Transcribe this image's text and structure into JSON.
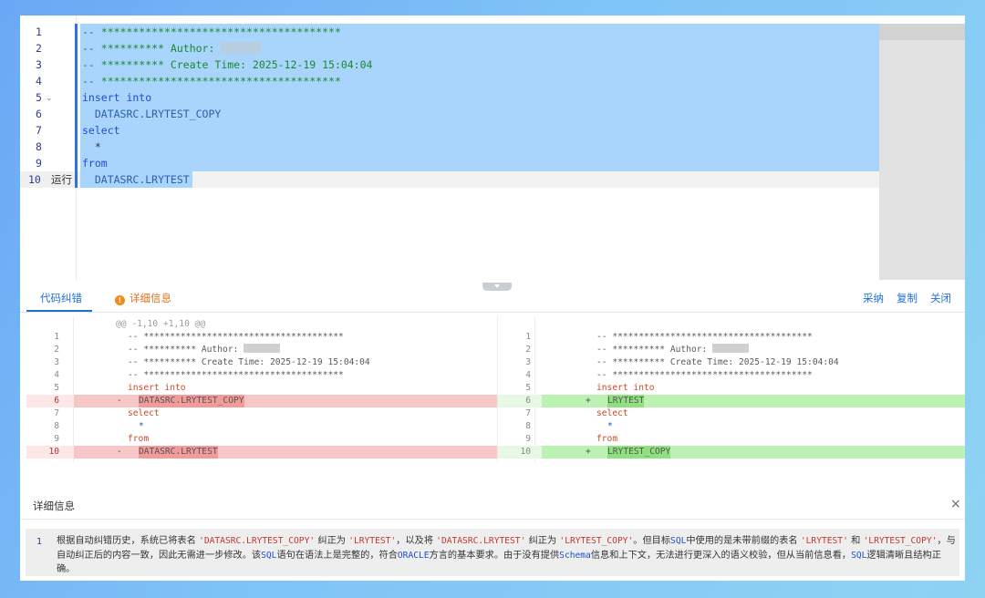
{
  "editor": {
    "run_label": "运行",
    "line_numbers": [
      "1",
      "2",
      "3",
      "4",
      "5",
      "6",
      "7",
      "8",
      "9",
      "10"
    ],
    "lines": {
      "l1": "-- **************************************",
      "l2": "-- ********** Author:",
      "l3": "-- ********** Create Time: 2025-12-19 15:04:04",
      "l4": "-- **************************************",
      "l5": "insert into",
      "l6": "  DATASRC.LRYTEST_COPY",
      "l7": "select",
      "l8": "  *",
      "l9": "from",
      "l10": "  DATASRC.LRYTEST"
    }
  },
  "tabs": {
    "correct": "代码纠错",
    "detail": "详细信息",
    "detail_icon": "!"
  },
  "actions": {
    "adopt": "采纳",
    "copy": "复制",
    "close": "关闭"
  },
  "diff": {
    "hunk": "@@ -1,10 +1,10 @@",
    "left": {
      "nums": [
        "1",
        "2",
        "3",
        "4",
        "5",
        "6",
        "7",
        "8",
        "9",
        "10"
      ],
      "l1": "-- **************************************",
      "l2": "-- ********** Author:",
      "l3": "-- ********** Create Time: 2025-12-19 15:04:04",
      "l4": "-- **************************************",
      "l5": "insert into",
      "l6": "DATASRC.LRYTEST_COPY",
      "l7": "select",
      "l8": "*",
      "l9": "from",
      "l10": "DATASRC.LRYTEST",
      "minus": "-"
    },
    "right": {
      "nums": [
        "1",
        "2",
        "3",
        "4",
        "5",
        "6",
        "7",
        "8",
        "9",
        "10"
      ],
      "l1": "-- **************************************",
      "l2": "-- ********** Author:",
      "l3": "-- ********** Create Time: 2025-12-19 15:04:04",
      "l4": "-- **************************************",
      "l5": "insert into",
      "l6": "LRYTEST",
      "l7": "select",
      "l8": "*",
      "l9": "from",
      "l10": "LRYTEST_COPY",
      "plus": "+"
    }
  },
  "detail_panel": {
    "title": "详细信息",
    "close_icon": "×",
    "line_number": "1",
    "segments": [
      "根据自动纠错历史，系统已将表名 ",
      "'DATASRC.LRYTEST_COPY'",
      " 纠正为 ",
      "'LRYTEST'",
      "，以及将 ",
      "'DATASRC.LRYTEST'",
      " 纠正为 ",
      "'LRYTEST_COPY'",
      "。但目标",
      "SQL",
      "中使用的是未带前缀的表名 ",
      "'LRYTEST'",
      " 和 ",
      "'LRYTEST_COPY'",
      "，与自动纠正后的内容一致，因此无需进一步修改。该",
      "SQL",
      "语句在语法上是完整的，符合",
      "ORACLE",
      "方言的基本要求。由于没有提供",
      "Schema",
      "信息和上下文，无法进行更深入的语义校验，但从当前信息看，",
      "SQL",
      "逻辑清晰且结构正确。"
    ]
  },
  "colors": {
    "selection": "#a9d4fb",
    "comment": "#1a8a2e",
    "keyword": "#1f4fd1",
    "accent": "#1f6fd6",
    "warning": "#f08a1c",
    "diff_removed": "#f7c6c6",
    "diff_added": "#bdf2b5"
  }
}
